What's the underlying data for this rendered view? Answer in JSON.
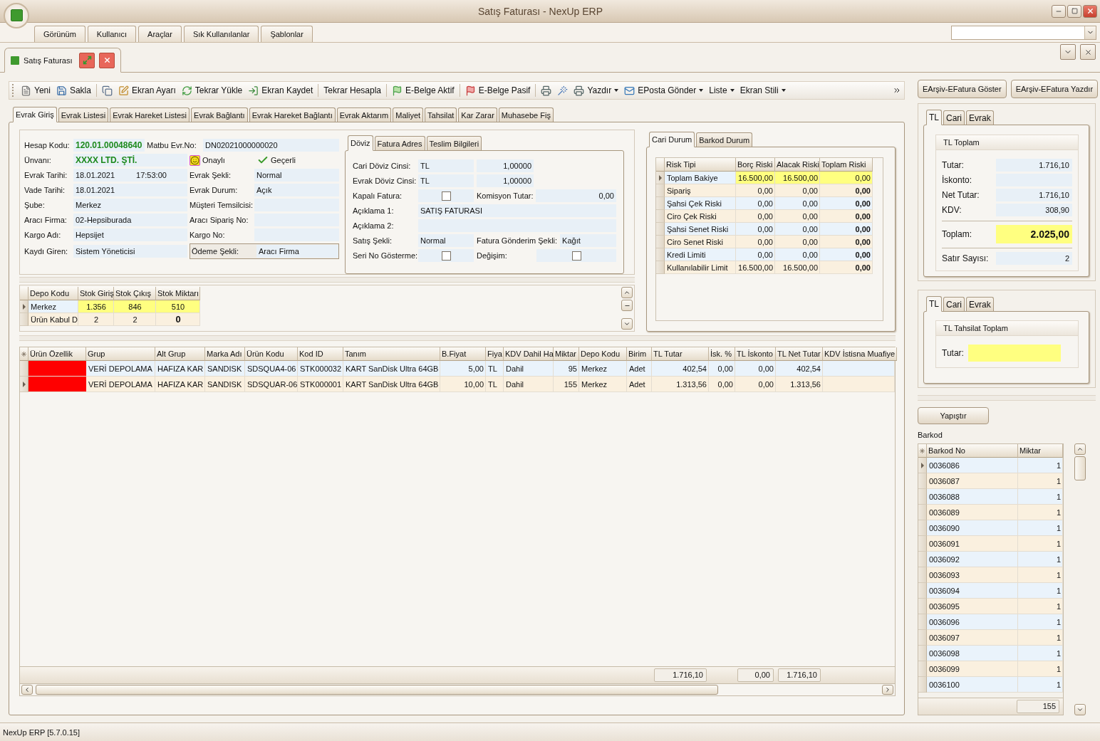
{
  "window": {
    "title": "Satış Faturası - NexUp ERP"
  },
  "menu_tabs": [
    "Görünüm",
    "Kullanıcı",
    "Araçlar",
    "Sık Kullanılanlar",
    "Şablonlar"
  ],
  "document_tab": {
    "label": "Satış Faturası"
  },
  "toolbar": [
    {
      "kind": "button",
      "label": "Yeni"
    },
    {
      "kind": "button",
      "label": "Sakla"
    },
    {
      "kind": "separator"
    },
    {
      "kind": "icon"
    },
    {
      "kind": "button",
      "label": "Ekran Ayarı"
    },
    {
      "kind": "button",
      "label": "Tekrar Yükle"
    },
    {
      "kind": "button",
      "label": "Ekran Kaydet"
    },
    {
      "kind": "separator"
    },
    {
      "kind": "button",
      "label": "Tekrar Hesapla"
    },
    {
      "kind": "separator"
    },
    {
      "kind": "button",
      "label": "E-Belge Aktif"
    },
    {
      "kind": "separator"
    },
    {
      "kind": "button",
      "label": "E-Belge Pasif"
    },
    {
      "kind": "separator"
    },
    {
      "kind": "icon"
    },
    {
      "kind": "icon"
    },
    {
      "kind": "dropdown",
      "label": "Yazdır"
    },
    {
      "kind": "dropdown",
      "label": "EPosta Gönder"
    },
    {
      "kind": "dropdown",
      "label": "Liste"
    },
    {
      "kind": "dropdown",
      "label": "Ekran Stili"
    }
  ],
  "tabs": [
    {
      "label": "Evrak Giriş",
      "selected": true
    },
    {
      "label": "Evrak Listesi",
      "selected": false
    },
    {
      "label": "Evrak Hareket Listesi",
      "selected": false
    },
    {
      "label": "Evrak Bağlantı",
      "selected": false
    },
    {
      "label": "Evrak Hareket Bağlantı",
      "selected": false
    },
    {
      "label": "Evrak Aktarım",
      "selected": false
    },
    {
      "label": "Maliyet",
      "selected": false
    },
    {
      "label": "Tahsilat",
      "selected": false
    },
    {
      "label": "Kar Zarar",
      "selected": false
    },
    {
      "label": "Muhasebe Fiş",
      "selected": false
    }
  ],
  "document_form": {
    "rows": [
      {
        "kind": "header",
        "cells": [
          {
            "label": "Hesap Kodu:",
            "value": "120.01.00048640",
            "emphasis": true
          },
          {
            "label": "Matbu Evr.No:",
            "value": "DN02021000000020"
          }
        ]
      },
      {
        "kind": "title",
        "cells": [
          {
            "label": "Ünvanı:",
            "value": "XXXX LTD. ŞTİ.",
            "emphasis": true
          }
        ],
        "statuses": [
          {
            "kind": "approved",
            "label": "Onaylı"
          },
          {
            "kind": "valid",
            "label": "Geçerli"
          }
        ]
      },
      {
        "kind": "pair",
        "cells": [
          {
            "label": "Evrak Tarihi:",
            "value": "18.01.2021",
            "time": "17:53:00"
          },
          {
            "label": "Evrak Şekli:",
            "value": "Normal"
          }
        ]
      },
      {
        "kind": "pair",
        "cells": [
          {
            "label": "Vade Tarihi:",
            "value": "18.01.2021"
          },
          {
            "label": "Evrak Durum:",
            "value": "Açık"
          }
        ]
      },
      {
        "kind": "pair",
        "cells": [
          {
            "label": "Şube:",
            "value": "Merkez"
          },
          {
            "label": "Müşteri Temsilcisi:"
          }
        ]
      },
      {
        "kind": "pair",
        "cells": [
          {
            "label": "Aracı Firma:",
            "value": "02-Hepsiburada"
          },
          {
            "label": "Aracı Sipariş No:"
          }
        ]
      },
      {
        "kind": "pair",
        "cells": [
          {
            "label": "Kargo Adı:",
            "value": "Hepsijet"
          },
          {
            "label": "Kargo No:"
          }
        ]
      },
      {
        "kind": "pair",
        "cells": [
          {
            "label": "Kaydı Giren:",
            "value": "Sistem Yöneticisi"
          },
          {
            "label": "Ödeme Şekli:",
            "value": "Aracı Firma",
            "focused": true
          }
        ]
      }
    ]
  },
  "currency_panel": {
    "tabs": [
      {
        "label": "Döviz",
        "selected": true
      },
      {
        "label": "Fatura Adres",
        "selected": false
      },
      {
        "label": "Teslim Bilgileri",
        "selected": false
      }
    ],
    "rows": [
      {
        "kind": "currency",
        "label": "Cari Döviz Cinsi:",
        "value": "TL",
        "rate": "1,00000"
      },
      {
        "kind": "currency",
        "label": "Evrak Döviz Cinsi:",
        "value": "TL",
        "rate": "1,00000"
      },
      {
        "kind": "check_amount",
        "label": "Kapalı Fatura:",
        "checked": false,
        "label2": "Komisyon Tutar:",
        "value2": "0,00"
      },
      {
        "kind": "wide",
        "label": "Açıklama 1:",
        "value": "SATIŞ FATURASI"
      },
      {
        "kind": "wide",
        "label": "Açıklama 2:"
      },
      {
        "kind": "pair",
        "label": "Satış Şekli:",
        "value": "Normal",
        "label2": "Fatura Gönderim Şekli:",
        "value2": "Kağıt"
      },
      {
        "kind": "checks",
        "label": "Seri No Gösterme:",
        "checked": false,
        "label2": "Değişim:",
        "checked2": false
      }
    ]
  },
  "stock": {
    "columns": [
      "Depo Kodu",
      "Stok Giriş",
      "Stok Çıkış",
      "Stok Miktarı"
    ],
    "rows": [
      {
        "selected": true,
        "cells": [
          "Merkez",
          "1.356",
          "846",
          "510"
        ]
      },
      {
        "selected": false,
        "cells": [
          "Ürün Kabul D",
          "2",
          "2",
          "0"
        ]
      }
    ]
  },
  "risk_panel": {
    "tabs": [
      {
        "label": "Cari Durum",
        "selected": true
      },
      {
        "label": "Barkod Durum",
        "selected": false
      }
    ],
    "columns": [
      "Risk Tipi",
      "Borç Riski",
      "Alacak Riski",
      "Toplam Riski"
    ],
    "rows": [
      {
        "selected": true,
        "cells": [
          "Toplam Bakiye",
          "16.500,00",
          "16.500,00",
          "0,00"
        ]
      },
      {
        "selected": false,
        "cells": [
          "Sipariş",
          "0,00",
          "0,00",
          "0,00"
        ]
      },
      {
        "selected": false,
        "cells": [
          "Şahsi Çek Riski",
          "0,00",
          "0,00",
          "0,00"
        ]
      },
      {
        "selected": false,
        "cells": [
          "Ciro Çek Riski",
          "0,00",
          "0,00",
          "0,00"
        ]
      },
      {
        "selected": false,
        "cells": [
          "Şahsi Senet Riski",
          "0,00",
          "0,00",
          "0,00"
        ]
      },
      {
        "selected": false,
        "cells": [
          "Ciro Senet Riski",
          "0,00",
          "0,00",
          "0,00"
        ]
      },
      {
        "selected": false,
        "cells": [
          "Kredi Limiti",
          "0,00",
          "0,00",
          "0,00"
        ]
      },
      {
        "selected": false,
        "cells": [
          "Kullanılabilir Limit",
          "16.500,00",
          "16.500,00",
          "0,00"
        ]
      }
    ]
  },
  "lines": {
    "columns": [
      {
        "label": "Ürün Özellik"
      },
      {
        "label": "Grup"
      },
      {
        "label": "Alt Grup"
      },
      {
        "label": "Marka Adı"
      },
      {
        "label": "Ürün Kodu"
      },
      {
        "label": "Kod ID"
      },
      {
        "label": "Tanım"
      },
      {
        "label": "B.Fiyat"
      },
      {
        "label": "Fiya"
      },
      {
        "label": "KDV Dahil Ha"
      },
      {
        "label": "Miktar"
      },
      {
        "label": "Depo Kodu"
      },
      {
        "label": "Birim"
      },
      {
        "label": "TL Tutar",
        "total": "1.716,10"
      },
      {
        "label": "İsk. %"
      },
      {
        "label": "TL İskonto",
        "total": "0,00"
      },
      {
        "label": "TL Net Tutar",
        "total": "1.716,10"
      },
      {
        "label": "KDV İstisna Muafiye"
      }
    ],
    "rows": [
      {
        "selected": false,
        "color": "#ff0000",
        "cells": [
          "",
          "VERİ DEPOLAMA",
          "HAFIZA KAR",
          "SANDISK",
          "SDSQUA4-06",
          "STK000032",
          "KART SanDisk Ultra 64GB",
          "5,00",
          "TL",
          "Dahil",
          "95",
          "Merkez",
          "Adet",
          "402,54",
          "0,00",
          "0,00",
          "402,54"
        ]
      },
      {
        "selected": true,
        "color": "#ff0000",
        "cells": [
          "",
          "VERİ DEPOLAMA",
          "HAFIZA KAR",
          "SANDISK",
          "SDSQUAR-06",
          "STK000001",
          "KART SanDisk Ultra 64GB",
          "10,00",
          "TL",
          "Dahil",
          "155",
          "Merkez",
          "Adet",
          "1.313,56",
          "0,00",
          "0,00",
          "1.313,56"
        ]
      }
    ]
  },
  "action_buttons": [
    "EArşiv-EFatura Göster",
    "EArşiv-EFatura Yazdır"
  ],
  "totals_panel": {
    "tabs": [
      {
        "label": "TL",
        "selected": true
      },
      {
        "label": "Cari",
        "selected": false
      },
      {
        "label": "Evrak",
        "selected": false
      }
    ],
    "title": "TL Toplam",
    "rows": [
      {
        "kind": "amount",
        "label": "Tutar:",
        "value": "1.716,10"
      },
      {
        "kind": "amount",
        "label": "İskonto:"
      },
      {
        "kind": "amount",
        "label": "Net Tutar:",
        "value": "1.716,10"
      },
      {
        "kind": "amount",
        "label": "KDV:",
        "value": "308,90"
      },
      {
        "kind": "total",
        "label": "Toplam:",
        "value": "2.025,00"
      },
      {
        "kind": "count",
        "label": "Satır Sayısı:",
        "value": "2"
      }
    ]
  },
  "collection_panel": {
    "tabs": [
      {
        "label": "TL",
        "selected": true
      },
      {
        "label": "Cari",
        "selected": false
      },
      {
        "label": "Evrak",
        "selected": false
      }
    ],
    "title": "TL Tahsilat Toplam",
    "label": "Tutar:"
  },
  "paste_button": "Yapıştır",
  "barcode": {
    "title": "Barkod",
    "columns": [
      "Barkod No",
      "Miktar"
    ],
    "rows": [
      {
        "selected": true,
        "code": "0036086",
        "qty": "1"
      },
      {
        "selected": false,
        "code": "0036087",
        "qty": "1"
      },
      {
        "selected": false,
        "code": "0036088",
        "qty": "1"
      },
      {
        "selected": false,
        "code": "0036089",
        "qty": "1"
      },
      {
        "selected": false,
        "code": "0036090",
        "qty": "1"
      },
      {
        "selected": false,
        "code": "0036091",
        "qty": "1"
      },
      {
        "selected": false,
        "code": "0036092",
        "qty": "1"
      },
      {
        "selected": false,
        "code": "0036093",
        "qty": "1"
      },
      {
        "selected": false,
        "code": "0036094",
        "qty": "1"
      },
      {
        "selected": false,
        "code": "0036095",
        "qty": "1"
      },
      {
        "selected": false,
        "code": "0036096",
        "qty": "1"
      },
      {
        "selected": false,
        "code": "0036097",
        "qty": "1"
      },
      {
        "selected": false,
        "code": "0036098",
        "qty": "1"
      },
      {
        "selected": false,
        "code": "0036099",
        "qty": "1"
      },
      {
        "selected": false,
        "code": "0036100",
        "qty": "1"
      }
    ],
    "total": "155"
  },
  "status_bar": "NexUp ERP [5.7.0.15]"
}
